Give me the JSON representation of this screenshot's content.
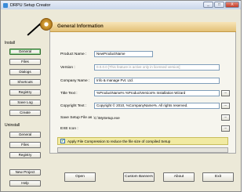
{
  "window": {
    "title": "DRPU Setup Creator",
    "minimize_glyph": "_",
    "maximize_glyph": "□",
    "close_glyph": "X"
  },
  "sidebar": {
    "install_label": "Install",
    "install_items": [
      "General",
      "Files",
      "Dialogs",
      "Shortcuts",
      "Registry",
      "Save Log",
      "Create"
    ],
    "uninstall_label": "Uninstall",
    "uninstall_items": [
      "General",
      "Files",
      "Registry"
    ],
    "new_project": "New Project",
    "help": "Help"
  },
  "section": {
    "title": "General Information"
  },
  "form": {
    "product_name": {
      "label": "Product Name :",
      "value": "NewProductName"
    },
    "version": {
      "label": "Version :",
      "value": "0.0.0.0 [This feature is active only in licensed version]"
    },
    "company_name": {
      "label": "Company Name :",
      "value": "Info & manage Pvt. Ltd."
    },
    "title_text": {
      "label": "Title Text :",
      "value": "%ProductName% %ProductVersion% Installation Wizard",
      "browse": "..."
    },
    "copyright_text": {
      "label": "Copyright Text :",
      "value": "Copyright © 2010, %CompanyName%. All rights reserved.",
      "browse": "..."
    },
    "save_setup": {
      "label": "Save Setup File as :",
      "value": "C:\\MySetup.exe",
      "browse": "..."
    },
    "exe_icon": {
      "label": "EXE Icon :",
      "browse": "..."
    }
  },
  "compression": {
    "checked": true,
    "check_glyph": "✓",
    "label": "Apply File Compression to reduce the file size of compiled Setup"
  },
  "progress": 0,
  "footer": {
    "open": "Open",
    "custom_banners": "Custom Banners",
    "about": "About",
    "exit": "Exit"
  },
  "colors": {
    "header_gradient": "#e3c077",
    "checkbox_row": "#f1eaa2",
    "field_border": "#7f9db9"
  }
}
